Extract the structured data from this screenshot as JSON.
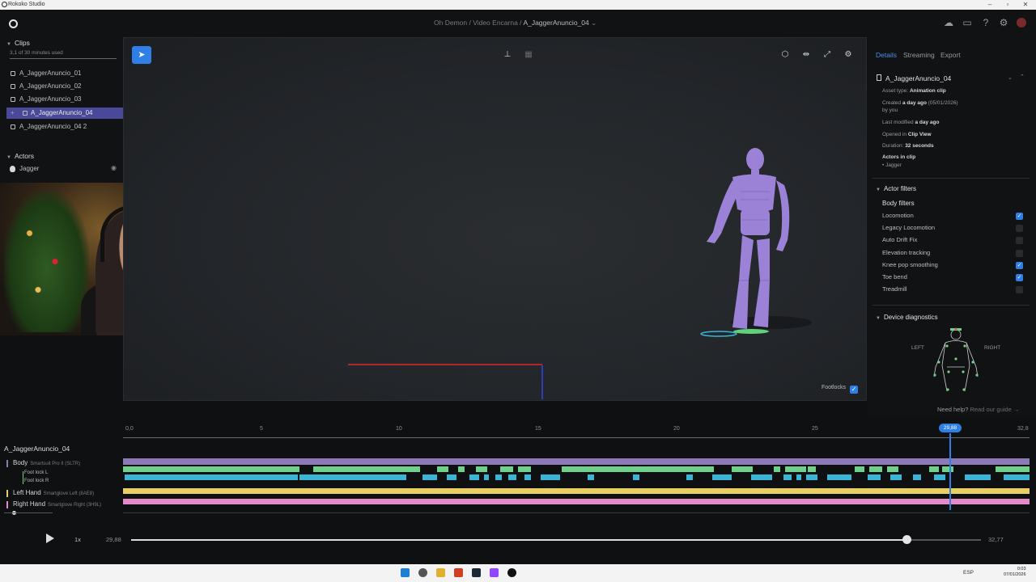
{
  "window": {
    "title": "Rokoko Studio"
  },
  "header": {
    "breadcrumb": [
      "Oh Demon",
      "Video Encarna",
      "A_JaggerAnuncio_04"
    ]
  },
  "clips": {
    "title": "Clips",
    "usage": "3,1 of 30 minutes used",
    "items": [
      "A_JaggerAnuncio_01",
      "A_JaggerAnuncio_02",
      "A_JaggerAnuncio_03",
      "A_JaggerAnuncio_04",
      "A_JaggerAnuncio_04 2"
    ],
    "selected_index": 3
  },
  "actors": {
    "title": "Actors",
    "items": [
      "Jagger"
    ]
  },
  "viewport": {
    "footlocks_label": "Footlocks",
    "footlocks_enabled": true
  },
  "details": {
    "tabs": [
      "Details",
      "Streaming",
      "Export"
    ],
    "active_tab": "Details",
    "asset_name": "A_JaggerAnuncio_04",
    "asset_type_label": "Asset type:",
    "asset_type_value": "Animation clip",
    "created_label": "Created",
    "created_value": "a day ago",
    "created_date": "(05/01/2026)",
    "created_by": "by you",
    "modified_label": "Last modified",
    "modified_value": "a day ago",
    "opened_label": "Opened in",
    "opened_value": "Clip View",
    "duration_label": "Duration:",
    "duration_value": "32 seconds",
    "actors_label": "Actors in clip",
    "actors_value": "• Jagger"
  },
  "actor_filters": {
    "title": "Actor filters",
    "subtitle": "Body filters",
    "items": [
      {
        "label": "Locomotion",
        "checked": true
      },
      {
        "label": "Legacy Locomotion",
        "checked": false
      },
      {
        "label": "Auto Drift Fix",
        "checked": false
      },
      {
        "label": "Elevation tracking",
        "checked": false
      },
      {
        "label": "Knee pop smoothing",
        "checked": true
      },
      {
        "label": "Toe bend",
        "checked": true
      },
      {
        "label": "Treadmill",
        "checked": false
      }
    ]
  },
  "device_diagnostics": {
    "title": "Device diagnostics",
    "left_label": "LEFT",
    "right_label": "RIGHT"
  },
  "help": {
    "text": "Need help?",
    "link": "Read our guide →"
  },
  "timeline": {
    "ticks": [
      "0,0",
      "5",
      "10",
      "15",
      "20",
      "25",
      "32,8"
    ],
    "playhead_label": "29,88",
    "clip_name": "A_JaggerAnuncio_04",
    "tracks": [
      {
        "name": "Body",
        "device": "Smartsuit Pro II (SLTR)",
        "color": "#8c7ab8"
      },
      {
        "name": "Left Hand",
        "device": "Smartglove Left (8AE8)",
        "color": "#e8cf63"
      },
      {
        "name": "Right Hand",
        "device": "Smartglove Right (3H9L)",
        "color": "#e58bc9"
      }
    ],
    "foot_locks": [
      "Foot lock L",
      "Foot lock R"
    ],
    "colors": {
      "green": "#6fd08c",
      "cyan": "#3ab5d6",
      "playhead": "#2f7fe6"
    }
  },
  "transport": {
    "speed": "1x",
    "current_time": "29,88",
    "end_time": "32,77",
    "progress": 0.912
  },
  "taskbar": {
    "lang": "ESP",
    "time": "0:03",
    "date": "07/01/2026"
  },
  "colors": {
    "accent": "#2f7fe6",
    "selection": "#4a4899",
    "avatar": "#9b82d6"
  }
}
